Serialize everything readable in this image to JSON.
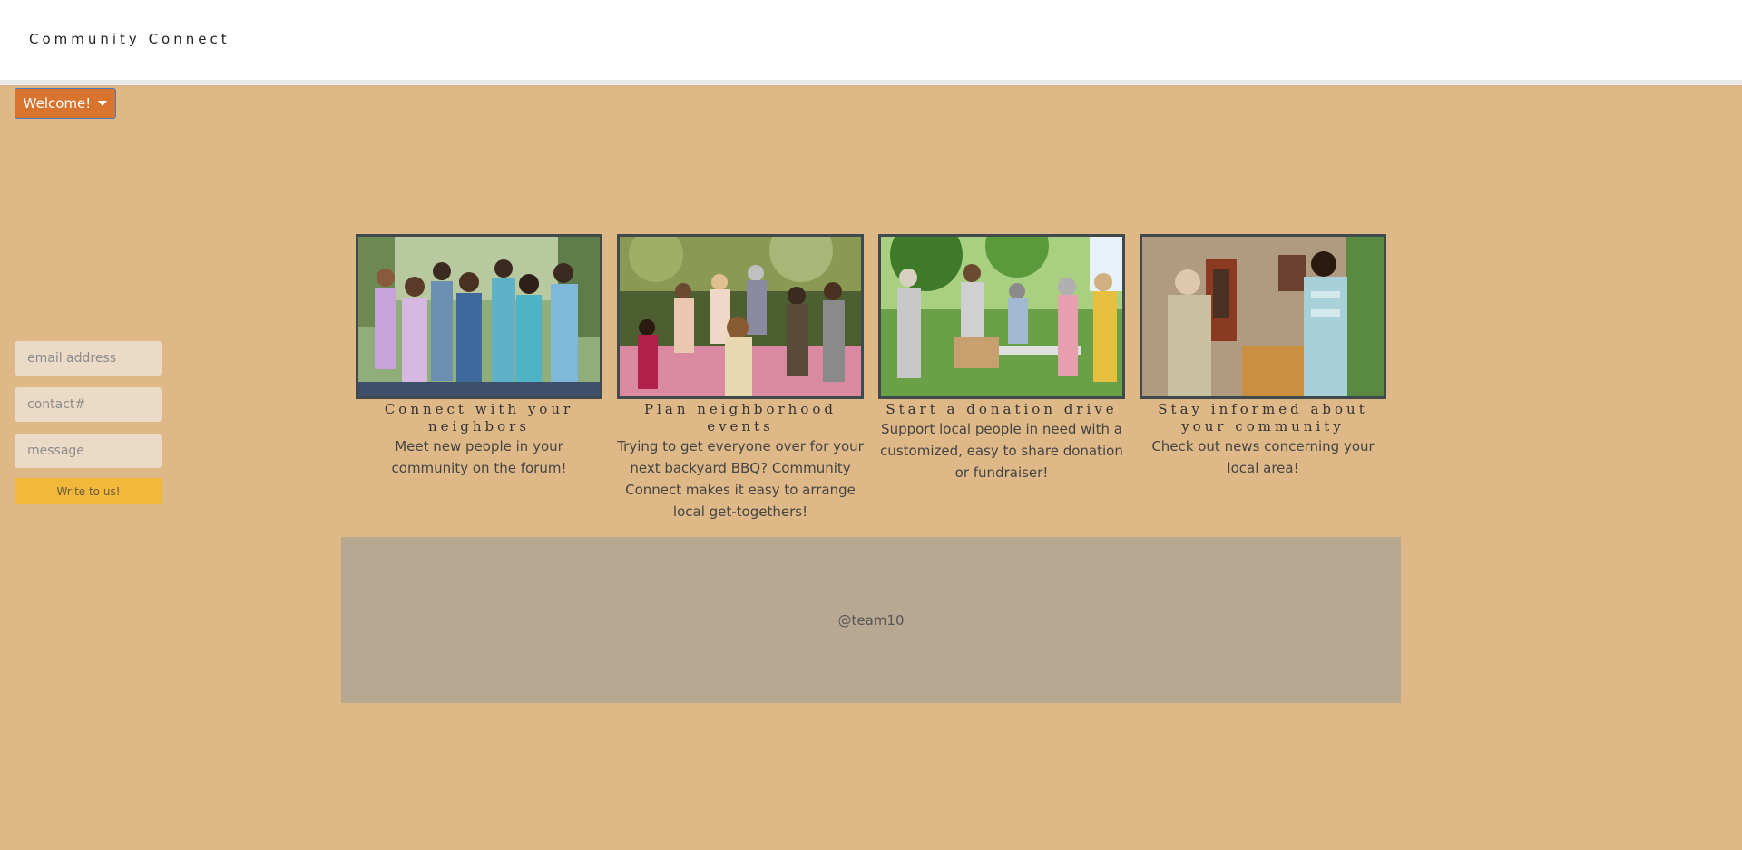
{
  "header": {
    "brand": "Community Connect"
  },
  "welcome_menu": {
    "label": "Welcome!"
  },
  "contact_form": {
    "email_placeholder": "email address",
    "contact_placeholder": "contact#",
    "message_placeholder": "message",
    "submit_label": "Write to us!"
  },
  "features": [
    {
      "title": "Connect with your neighbors",
      "description": "Meet new people in your community on the forum!"
    },
    {
      "title": "Plan neighborhood events",
      "description": "Trying to get everyone over for your next backyard BBQ? Community Connect makes it easy to arrange local get-togethers!"
    },
    {
      "title": "Start a donation drive",
      "description": "Support local people in need with a customized, easy to share donation or fundraiser!"
    },
    {
      "title": "Stay informed about your community",
      "description": "Check out news concerning your local area!"
    }
  ],
  "footer": {
    "text": "@team10"
  },
  "colors": {
    "background": "#deb887",
    "welcome_button": "#d9742f",
    "submit_button": "#f1b83a",
    "footer": "#b8a892"
  }
}
